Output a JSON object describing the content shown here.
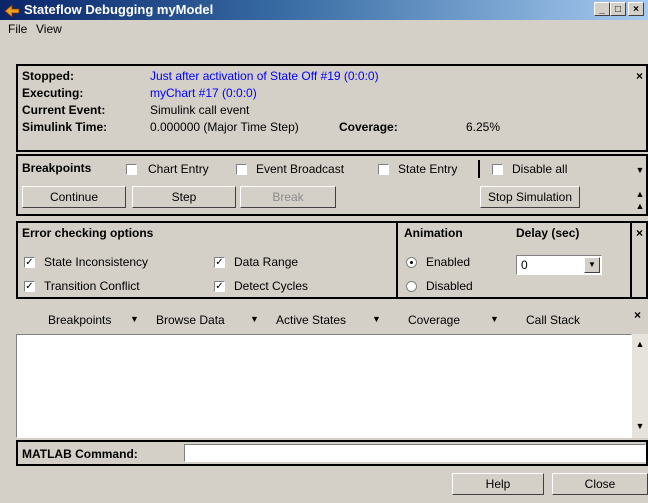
{
  "window": {
    "title": "Stateflow Debugging myModel",
    "minimize": "_",
    "maximize": "□",
    "close": "×"
  },
  "menu": {
    "file": "File",
    "view": "View"
  },
  "status": {
    "stopped_label": "Stopped:",
    "stopped_value": "Just after activation of State Off #19 (0:0:0)",
    "executing_label": "Executing:",
    "executing_value": "myChart #17 (0:0:0)",
    "current_event_label": "Current Event:",
    "current_event_value": "Simulink call event",
    "simulink_time_label": "Simulink Time:",
    "simulink_time_value": "0.000000 (Major Time Step)",
    "coverage_label": "Coverage:",
    "coverage_value": "6.25%",
    "close": "×"
  },
  "breakpoints": {
    "title": "Breakpoints",
    "chart_entry": "Chart Entry",
    "event_broadcast": "Event Broadcast",
    "state_entry": "State Entry",
    "disable_all": "Disable all",
    "continue": "Continue",
    "step": "Step",
    "break": "Break",
    "stop_simulation": "Stop Simulation"
  },
  "error_checking": {
    "title": "Error checking options",
    "state_inconsistency": "State Inconsistency",
    "data_range": "Data Range",
    "transition_conflict": "Transition Conflict",
    "detect_cycles": "Detect Cycles",
    "check_mark": "✓"
  },
  "animation": {
    "title": "Animation",
    "delay_label": "Delay (sec)",
    "enabled": "Enabled",
    "disabled": "Disabled",
    "delay_value": "0",
    "close": "×"
  },
  "tabs": {
    "breakpoints": "Breakpoints",
    "browse_data": "Browse Data",
    "active_states": "Active States",
    "coverage": "Coverage",
    "call_stack": "Call Stack",
    "arrow": "▼",
    "close": "×"
  },
  "command": {
    "label": "MATLAB Command:",
    "value": ""
  },
  "footer": {
    "help": "Help",
    "close": "Close"
  }
}
